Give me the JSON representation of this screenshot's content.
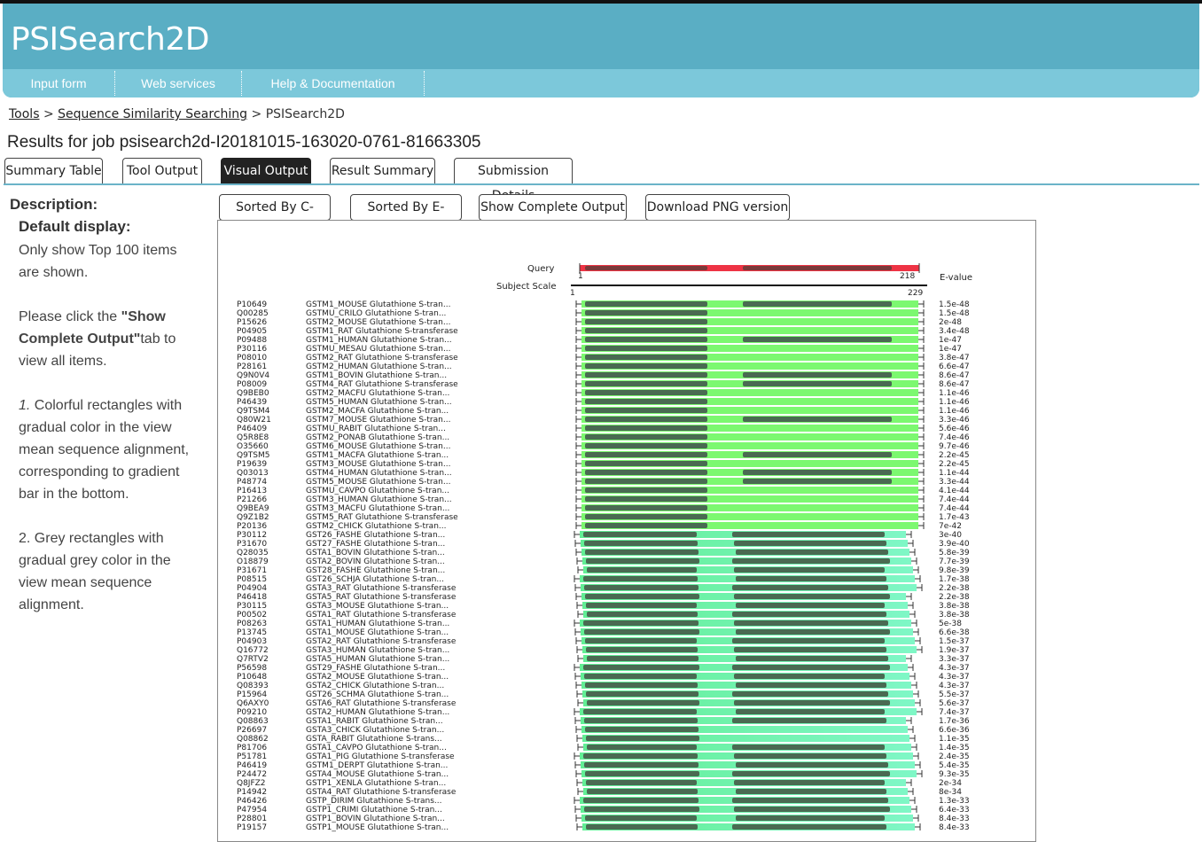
{
  "app": {
    "title": "PSISearch2D"
  },
  "nav": [
    "Input form",
    "Web services",
    "Help & Documentation"
  ],
  "breadcrumb": {
    "tools": "Tools",
    "sep": ">",
    "sss": "Sequence Similarity Searching",
    "current": "PSISearch2D"
  },
  "job": {
    "title": "Results for job psisearch2d-I20181015-163020-0761-81663305"
  },
  "tabs": [
    "Summary Table",
    "Tool Output",
    "Visual Output",
    "Result Summary",
    "Submission Details"
  ],
  "active_tab": "Visual Output",
  "description": {
    "heading": "Description:",
    "default_heading": "Default display:",
    "default_text": "Only show Top 100 items are shown.",
    "click_pre": "Please click the ",
    "click_bold": "\"Show Complete Output\"",
    "click_post": "tab to view all items.",
    "item1_num": "1.",
    "item1_text": " Colorful rectangles with gradual color in the view mean sequence alignment, corresponding to gradient bar in the bottom.",
    "item2_text": "2. Grey rectangles with gradual grey color in the view mean sequence alignment."
  },
  "buttons": [
    "Sorted By C-value",
    "Sorted By E-value",
    "Show Complete Output",
    "Download PNG version"
  ],
  "viz": {
    "query_label": "Query",
    "subject_label": "Subject Scale",
    "evalue_header": "E-value",
    "query_start": "1",
    "query_end": "218",
    "subject_start": "1",
    "subject_end": "229",
    "colors": {
      "query_bar": "#ee3344",
      "query_dark": "#7a3a3a",
      "bright_green": "#7cf870",
      "mint": "#6df3b0",
      "dark_segment": "#4a6a52"
    },
    "rows": [
      {
        "acc": "P10649",
        "name": "GSTM1_MOUSE Glutathione S-tran...",
        "ev": "1.5e-48"
      },
      {
        "acc": "Q00285",
        "name": "GSTMU_CRILO Glutathione S-tran...",
        "ev": "1.5e-48"
      },
      {
        "acc": "P15626",
        "name": "GSTM2_MOUSE Glutathione S-tran...",
        "ev": "2e-48"
      },
      {
        "acc": "P04905",
        "name": "GSTM1_RAT Glutathione S-transferase",
        "ev": "3.4e-48"
      },
      {
        "acc": "P09488",
        "name": "GSTM1_HUMAN Glutathione S-tran...",
        "ev": "1e-47"
      },
      {
        "acc": "P30116",
        "name": "GSTMU_MESAU Glutathione S-tran...",
        "ev": "1e-47"
      },
      {
        "acc": "P08010",
        "name": "GSTM2_RAT Glutathione S-transferase",
        "ev": "3.8e-47"
      },
      {
        "acc": "P28161",
        "name": "GSTM2_HUMAN Glutathione S-tran...",
        "ev": "6.6e-47"
      },
      {
        "acc": "Q9N0V4",
        "name": "GSTM1_BOVIN Glutathione S-tran...",
        "ev": "8.6e-47"
      },
      {
        "acc": "P08009",
        "name": "GSTM4_RAT Glutathione S-transferase",
        "ev": "8.6e-47"
      },
      {
        "acc": "Q9BEB0",
        "name": "GSTM2_MACFU Glutathione S-tran...",
        "ev": "1.1e-46"
      },
      {
        "acc": "P46439",
        "name": "GSTM5_HUMAN Glutathione S-tran...",
        "ev": "1.1e-46"
      },
      {
        "acc": "Q9TSM4",
        "name": "GSTM2_MACFA Glutathione S-tran...",
        "ev": "1.1e-46"
      },
      {
        "acc": "Q80W21",
        "name": "GSTM7_MOUSE Glutathione S-tran...",
        "ev": "3.3e-46"
      },
      {
        "acc": "P46409",
        "name": "GSTMU_RABIT Glutathione S-tran...",
        "ev": "5.6e-46"
      },
      {
        "acc": "Q5R8E8",
        "name": "GSTM2_PONAB Glutathione S-tran...",
        "ev": "7.4e-46"
      },
      {
        "acc": "O35660",
        "name": "GSTM6_MOUSE Glutathione S-tran...",
        "ev": "9.7e-46"
      },
      {
        "acc": "Q9TSM5",
        "name": "GSTM1_MACFA Glutathione S-tran...",
        "ev": "2.2e-45"
      },
      {
        "acc": "P19639",
        "name": "GSTM3_MOUSE Glutathione S-tran...",
        "ev": "2.2e-45"
      },
      {
        "acc": "Q03013",
        "name": "GSTM4_HUMAN Glutathione S-tran...",
        "ev": "1.1e-44"
      },
      {
        "acc": "P48774",
        "name": "GSTM5_MOUSE Glutathione S-tran...",
        "ev": "3.3e-44"
      },
      {
        "acc": "P16413",
        "name": "GSTMU_CAVPO Glutathione S-tran...",
        "ev": "4.1e-44"
      },
      {
        "acc": "P21266",
        "name": "GSTM3_HUMAN Glutathione S-tran...",
        "ev": "7.4e-44"
      },
      {
        "acc": "Q9BEA9",
        "name": "GSTM3_MACFU Glutathione S-tran...",
        "ev": "7.4e-44"
      },
      {
        "acc": "Q9Z1B2",
        "name": "GSTM5_RAT Glutathione S-transferase",
        "ev": "1.7e-43"
      },
      {
        "acc": "P20136",
        "name": "GSTM2_CHICK Glutathione S-tran...",
        "ev": "7e-42"
      },
      {
        "acc": "P30112",
        "name": "GST26_FASHE Glutathione S-tran...",
        "ev": "3e-40"
      },
      {
        "acc": "P31670",
        "name": "GST27_FASHE Glutathione S-tran...",
        "ev": "3.9e-40"
      },
      {
        "acc": "Q28035",
        "name": "GSTA1_BOVIN Glutathione S-tran...",
        "ev": "5.8e-39"
      },
      {
        "acc": "O18879",
        "name": "GSTA2_BOVIN Glutathione S-tran...",
        "ev": "7.7e-39"
      },
      {
        "acc": "P31671",
        "name": "GST28_FASHE Glutathione S-tran...",
        "ev": "9.8e-39"
      },
      {
        "acc": "P08515",
        "name": "GST26_SCHJA Glutathione S-tran...",
        "ev": "1.7e-38"
      },
      {
        "acc": "P04904",
        "name": "GSTA3_RAT Glutathione S-transferase",
        "ev": "2.2e-38"
      },
      {
        "acc": "P46418",
        "name": "GSTA5_RAT Glutathione S-transferase",
        "ev": "2.2e-38"
      },
      {
        "acc": "P30115",
        "name": "GSTA3_MOUSE Glutathione S-tran...",
        "ev": "3.8e-38"
      },
      {
        "acc": "P00502",
        "name": "GSTA1_RAT Glutathione S-transferase",
        "ev": "3.8e-38"
      },
      {
        "acc": "P08263",
        "name": "GSTA1_HUMAN Glutathione S-tran...",
        "ev": "5e-38"
      },
      {
        "acc": "P13745",
        "name": "GSTA1_MOUSE Glutathione S-tran...",
        "ev": "6.6e-38"
      },
      {
        "acc": "P04903",
        "name": "GSTA2_RAT Glutathione S-transferase",
        "ev": "1.5e-37"
      },
      {
        "acc": "Q16772",
        "name": "GSTA3_HUMAN Glutathione S-tran...",
        "ev": "1.9e-37"
      },
      {
        "acc": "Q7RTV2",
        "name": "GSTA5_HUMAN Glutathione S-tran...",
        "ev": "3.3e-37"
      },
      {
        "acc": "P56598",
        "name": "GST29_FASHE Glutathione S-tran...",
        "ev": "4.3e-37"
      },
      {
        "acc": "P10648",
        "name": "GSTA2_MOUSE Glutathione S-tran...",
        "ev": "4.3e-37"
      },
      {
        "acc": "Q08393",
        "name": "GSTA2_CHICK Glutathione S-tran...",
        "ev": "4.3e-37"
      },
      {
        "acc": "P15964",
        "name": "GST26_SCHMA Glutathione S-tran...",
        "ev": "5.5e-37"
      },
      {
        "acc": "Q6AXY0",
        "name": "GSTA6_RAT Glutathione S-transferase",
        "ev": "5.6e-37"
      },
      {
        "acc": "P09210",
        "name": "GSTA2_HUMAN Glutathione S-tran...",
        "ev": "7.4e-37"
      },
      {
        "acc": "Q08863",
        "name": "GSTA1_RABIT Glutathione S-tran...",
        "ev": "1.7e-36"
      },
      {
        "acc": "P26697",
        "name": "GSTA3_CHICK Glutathione S-tran...",
        "ev": "6.6e-36"
      },
      {
        "acc": "Q08862",
        "name": "GSTA_RABIT Glutathione S-trans...",
        "ev": "1.1e-35"
      },
      {
        "acc": "P81706",
        "name": "GSTA1_CAVPO Glutathione S-tran...",
        "ev": "1.4e-35"
      },
      {
        "acc": "P51781",
        "name": "GSTA1_PIG Glutathione S-transferase",
        "ev": "2.4e-35"
      },
      {
        "acc": "P46419",
        "name": "GSTM1_DERPT Glutathione S-tran...",
        "ev": "5.4e-35"
      },
      {
        "acc": "P24472",
        "name": "GSTA4_MOUSE Glutathione S-tran...",
        "ev": "9.3e-35"
      },
      {
        "acc": "Q8JFZ2",
        "name": "GSTP1_XENLA Glutathione S-tran...",
        "ev": "2e-34"
      },
      {
        "acc": "P14942",
        "name": "GSTA4_RAT Glutathione S-transferase",
        "ev": "8e-34"
      },
      {
        "acc": "P46426",
        "name": "GSTP_DIRIM Glutathione S-trans...",
        "ev": "1.3e-33"
      },
      {
        "acc": "P47954",
        "name": "GSTP1_CRIMI Glutathione S-tran...",
        "ev": "6.4e-33"
      },
      {
        "acc": "P28801",
        "name": "GSTP1_BOVIN Glutathione S-tran...",
        "ev": "8.4e-33"
      },
      {
        "acc": "P19157",
        "name": "GSTP1_MOUSE Glutathione S-tran...",
        "ev": "8.4e-33"
      }
    ]
  }
}
